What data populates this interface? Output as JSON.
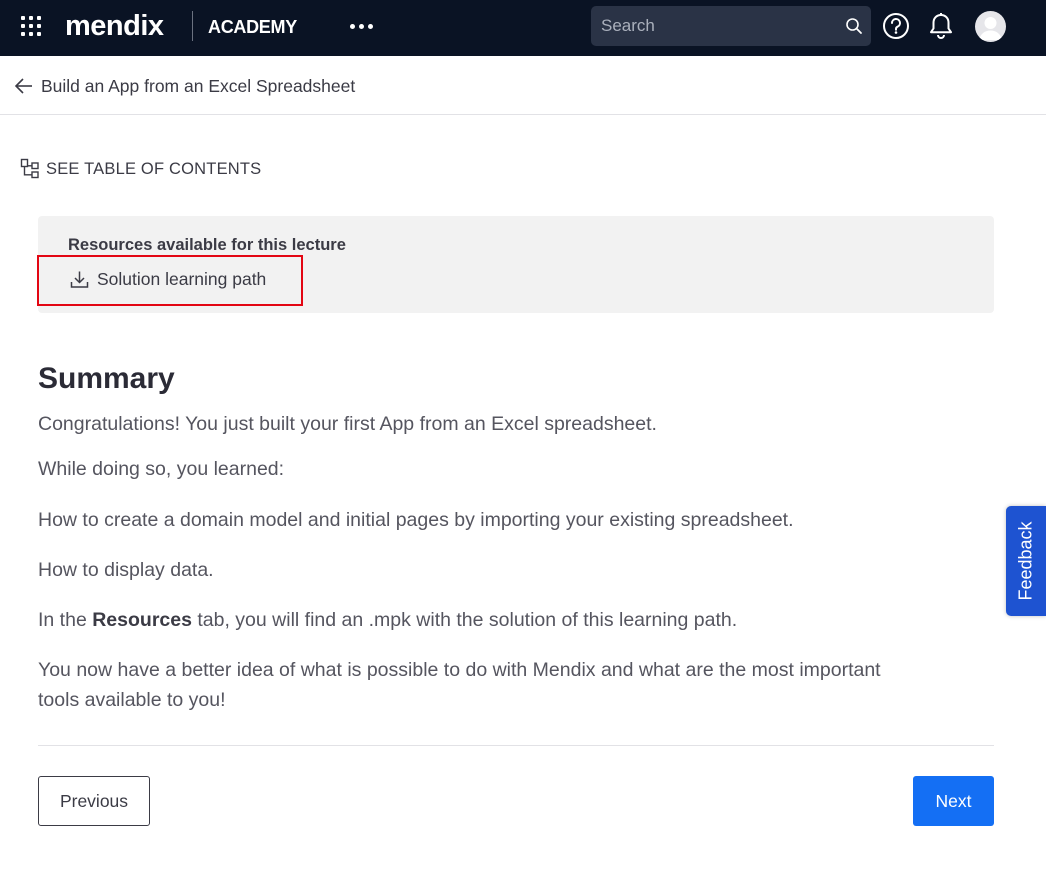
{
  "topbar": {
    "logo": "mendix",
    "section": "ACADEMY",
    "search_placeholder": "Search",
    "icons": [
      "apps-grid-icon",
      "more-horizontal-icon",
      "search-icon",
      "help-icon",
      "bell-icon",
      "user-avatar-icon"
    ]
  },
  "breadcrumb": {
    "back_label": "Build an App from an Excel Spreadsheet"
  },
  "toc": {
    "label": "SEE TABLE OF CONTENTS"
  },
  "resources": {
    "heading": "Resources available for this lecture",
    "link_label": "Solution learning path"
  },
  "content": {
    "title": "Summary",
    "p1": "Congratulations! You just built your first App from an Excel spreadsheet.",
    "p2": "While doing so, you learned:",
    "p3": "How to create a domain model and initial pages by importing your existing spreadsheet.",
    "p4": "How to display data.",
    "p5_before": "In the ",
    "p5_bold": "Resources",
    "p5_after": " tab, you will find an .mpk with the solution of this learning path.",
    "p6": "You now have a better idea of what is possible to do with Mendix and what are the most important tools available to you!"
  },
  "nav": {
    "previous_label": "Previous",
    "next_label": "Next"
  },
  "feedback": {
    "label": "Feedback"
  },
  "colors": {
    "navbar": "#0a1324",
    "primary_button": "#146ff4",
    "feedback_tab": "#1e53d1",
    "highlight": "#e30613"
  }
}
